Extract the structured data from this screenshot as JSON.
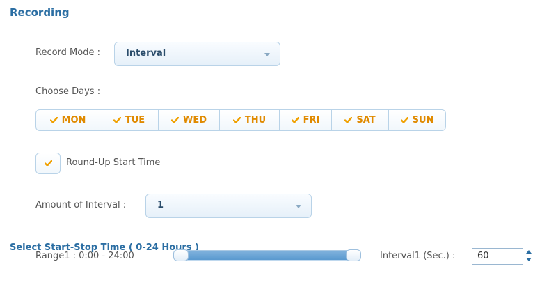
{
  "recording": {
    "title": "Recording",
    "record_mode": {
      "label": "Record Mode :",
      "value": "Interval"
    },
    "choose_days": {
      "label": "Choose Days :",
      "days": [
        {
          "label": "MON",
          "checked": true
        },
        {
          "label": "TUE",
          "checked": true
        },
        {
          "label": "WED",
          "checked": true
        },
        {
          "label": "THU",
          "checked": true
        },
        {
          "label": "FRI",
          "checked": true
        },
        {
          "label": "SAT",
          "checked": true
        },
        {
          "label": "SUN",
          "checked": true
        }
      ]
    },
    "round_up": {
      "label": "Round-Up Start Time",
      "checked": true
    },
    "amount_of_interval": {
      "label": "Amount of Interval :",
      "value": "1"
    }
  },
  "start_stop": {
    "title": "Select Start-Stop Time ( 0-24 Hours )",
    "range1": {
      "label": "Range1 : 0:00 - 24:00",
      "start": "0:00",
      "end": "24:00"
    },
    "interval1": {
      "label": "Interval1 (Sec.) :",
      "value": "60"
    }
  },
  "colors": {
    "accent": "#2b6ea3",
    "check": "#f0a000",
    "day_text": "#e08a00"
  },
  "icons": {
    "check": "check-icon",
    "caret": "chevron-down-icon"
  }
}
